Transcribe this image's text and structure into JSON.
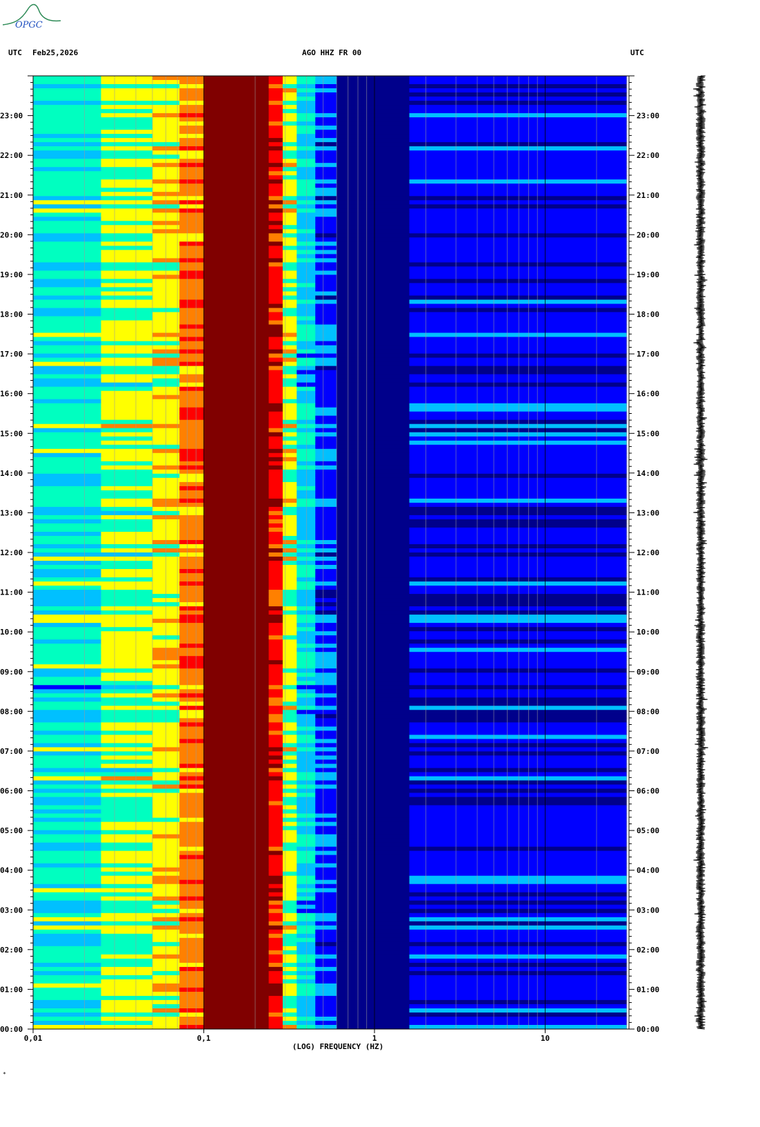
{
  "header": {
    "left_tz": "UTC",
    "date": "Feb25,2026",
    "station": "AGO HHZ FR 00",
    "right_tz": "UTC",
    "logo_text": "OPGC"
  },
  "footer_mark": "*",
  "chart_data": {
    "type": "heatmap",
    "title": "AGO HHZ FR 00",
    "xlabel": "(LOG) FREQUENCY (HZ)",
    "ylabel": "UTC",
    "x_scale": "log",
    "xlim": [
      0.01,
      30
    ],
    "x_ticks": [
      {
        "value": 0.01,
        "label": "0,01"
      },
      {
        "value": 0.1,
        "label": "0,1"
      },
      {
        "value": 1,
        "label": "1"
      },
      {
        "value": 10,
        "label": "10"
      }
    ],
    "y_ticks": [
      "00:00",
      "01:00",
      "02:00",
      "03:00",
      "04:00",
      "05:00",
      "06:00",
      "07:00",
      "08:00",
      "09:00",
      "10:00",
      "11:00",
      "12:00",
      "13:00",
      "14:00",
      "15:00",
      "16:00",
      "17:00",
      "18:00",
      "19:00",
      "20:00",
      "21:00",
      "22:00",
      "23:00"
    ],
    "ylim_hours": [
      0,
      24
    ],
    "colormap": [
      "#00008b",
      "#0000ff",
      "#00c0ff",
      "#00ffc0",
      "#ffff00",
      "#ff8000",
      "#ff0000",
      "#800000"
    ],
    "bands": [
      {
        "f_min": 0.01,
        "f_max": 0.025,
        "level": 0.38
      },
      {
        "f_min": 0.025,
        "f_max": 0.05,
        "level": 0.5
      },
      {
        "f_min": 0.05,
        "f_max": 0.072,
        "level": 0.57
      },
      {
        "f_min": 0.072,
        "f_max": 0.1,
        "level": 0.72
      },
      {
        "f_min": 0.1,
        "f_max": 0.24,
        "level": 1.0
      },
      {
        "f_min": 0.24,
        "f_max": 0.29,
        "level": 0.85
      },
      {
        "f_min": 0.29,
        "f_max": 0.35,
        "level": 0.52
      },
      {
        "f_min": 0.35,
        "f_max": 0.45,
        "level": 0.33
      },
      {
        "f_min": 0.45,
        "f_max": 0.6,
        "level": 0.18
      },
      {
        "f_min": 0.6,
        "f_max": 1.6,
        "level": 0.04
      },
      {
        "f_min": 1.6,
        "f_max": 30,
        "level": 0.12
      }
    ]
  }
}
